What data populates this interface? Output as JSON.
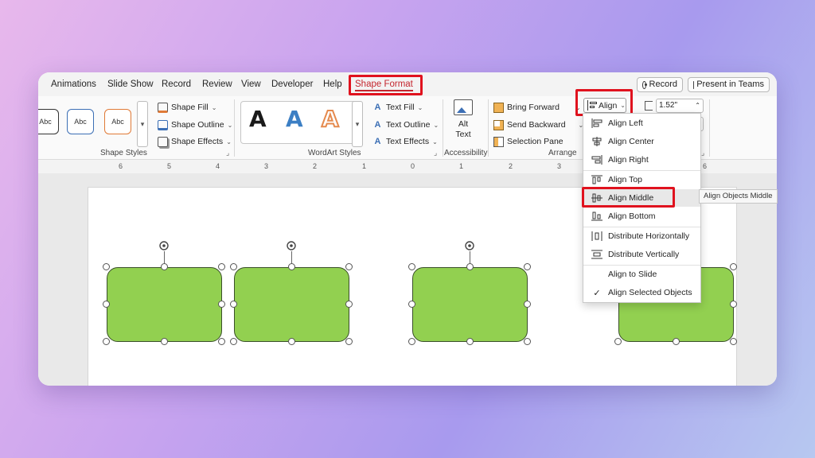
{
  "tabs": [
    {
      "label": "Animations"
    },
    {
      "label": "Slide Show"
    },
    {
      "label": "Record"
    },
    {
      "label": "Review"
    },
    {
      "label": "View"
    },
    {
      "label": "Developer"
    },
    {
      "label": "Help"
    },
    {
      "label": "Shape Format",
      "active": true
    }
  ],
  "header_buttons": {
    "record": "Record",
    "present_in_teams": "Present in Teams"
  },
  "ribbon": {
    "shape_styles": {
      "swatches": [
        "Abc",
        "Abc",
        "Abc"
      ],
      "shape_fill": "Shape Fill",
      "shape_outline": "Shape Outline",
      "shape_effects": "Shape Effects",
      "label": "Shape Styles"
    },
    "wordart": {
      "letters": [
        "A",
        "A",
        "A"
      ],
      "text_fill": "Text Fill",
      "text_outline": "Text Outline",
      "text_effects": "Text Effects",
      "label": "WordArt Styles"
    },
    "accessibility": {
      "alt_text_line1": "Alt",
      "alt_text_line2": "Text",
      "label": "Accessibility"
    },
    "arrange": {
      "bring_forward": "Bring Forward",
      "send_backward": "Send Backward",
      "selection_pane": "Selection Pane",
      "align": "Align",
      "label": "Arrange"
    },
    "size": {
      "height_value": "1.52\""
    }
  },
  "ruler": {
    "labels": [
      "6",
      "5",
      "4",
      "3",
      "2",
      "1",
      "0",
      "1",
      "2",
      "3",
      "6"
    ]
  },
  "align_menu": {
    "items": [
      {
        "label": "Align Left",
        "icon": "align-left-icon"
      },
      {
        "label": "Align Center",
        "icon": "align-center-icon"
      },
      {
        "label": "Align Right",
        "icon": "align-right-icon"
      },
      {
        "label": "Align Top",
        "icon": "align-top-icon"
      },
      {
        "label": "Align Middle",
        "icon": "align-middle-icon",
        "highlighted": true
      },
      {
        "label": "Align Bottom",
        "icon": "align-bottom-icon"
      },
      {
        "label": "Distribute Horizontally",
        "icon": "distribute-horizontal-icon"
      },
      {
        "label": "Distribute Vertically",
        "icon": "distribute-vertical-icon"
      },
      {
        "label": "Align to Slide",
        "icon": ""
      },
      {
        "label": "Align Selected Objects",
        "icon": "checkmark-icon",
        "checked": true
      }
    ],
    "tooltip": "Align Objects Middle"
  },
  "colors": {
    "shape_fill": "#92d050",
    "highlight": "#e0121e",
    "active_tab": "#c4262e"
  }
}
